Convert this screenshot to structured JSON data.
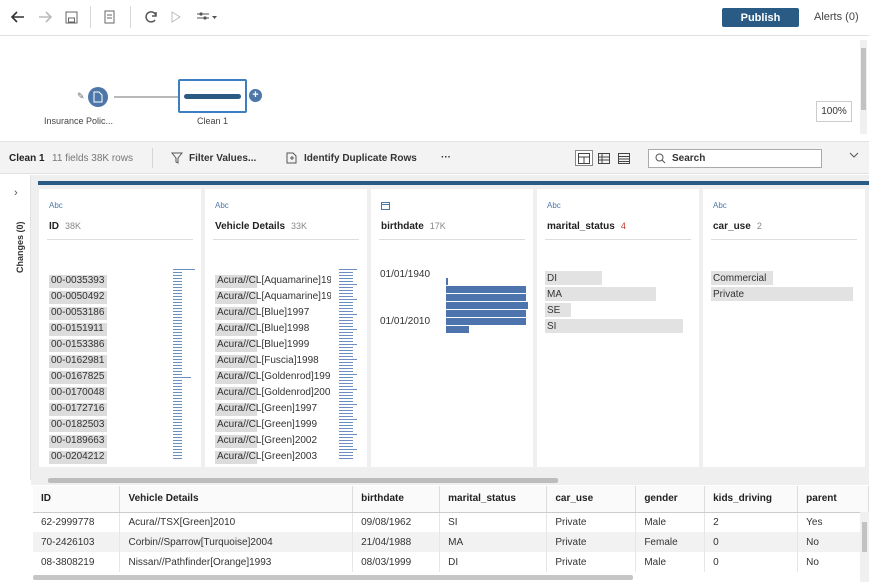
{
  "toolbar": {
    "icons": [
      "back-arrow-icon",
      "forward-arrow-icon",
      "save-icon",
      "save-to-file-icon",
      "refresh-icon",
      "run-icon",
      "flow-options-icon"
    ],
    "publish_label": "Publish",
    "alerts_label": "Alerts (0)"
  },
  "flow": {
    "input_node_label": "Insurance Polic...",
    "clean_node_label": "Clean 1",
    "zoom": "100%"
  },
  "step": {
    "title": "Clean 1",
    "meta": "11 fields  38K rows",
    "filter_label": "Filter Values...",
    "duplicate_label": "Identify Duplicate Rows",
    "more_label": "···",
    "search_label": "Search"
  },
  "changes": {
    "label": "Changes (0)"
  },
  "profile": {
    "cards": [
      {
        "type": "Abc",
        "name": "ID",
        "count": "38K",
        "values": [
          "00-0035393",
          "00-0050492",
          "00-0053186",
          "00-0151911",
          "00-0153386",
          "00-0162981",
          "00-0167825",
          "00-0170048",
          "00-0172716",
          "00-0182503",
          "00-0189663",
          "00-0204212"
        ]
      },
      {
        "type": "Abc",
        "name": "Vehicle Details",
        "count": "33K",
        "values": [
          "Acura//CL[Aquamarine]19",
          "Acura//CL[Aquamarine]19",
          "Acura//CL[Blue]1997",
          "Acura//CL[Blue]1998",
          "Acura//CL[Blue]1999",
          "Acura//CL[Fuscia]1998",
          "Acura//CL[Goldenrod]199",
          "Acura//CL[Goldenrod]200",
          "Acura//CL[Green]1997",
          "Acura//CL[Green]1999",
          "Acura//CL[Green]2002",
          "Acura//CL[Green]2003"
        ]
      },
      {
        "type": "date",
        "name": "birthdate",
        "count": "17K",
        "labels": [
          "01/01/1940",
          "01/01/2010"
        ],
        "histogram": [
          0.02,
          0.98,
          0.97,
          1.0,
          0.98,
          0.97,
          0.28
        ]
      },
      {
        "type": "Abc",
        "name": "marital_status",
        "count": "4",
        "values": [
          "DI",
          "MA",
          "SE",
          "SI"
        ],
        "proportions": [
          0.4,
          0.78,
          0.18,
          0.97
        ]
      },
      {
        "type": "Abc",
        "name": "car_use",
        "count": "2",
        "values": [
          "Commercial",
          "Private"
        ],
        "proportions": [
          0.44,
          1.0
        ]
      }
    ]
  },
  "grid": {
    "columns": [
      "ID",
      "Vehicle Details",
      "birthdate",
      "marital_status",
      "car_use",
      "gender",
      "kids_driving",
      "parent"
    ],
    "rows": [
      [
        "62-2999778",
        "Acura//TSX[Green]2010",
        "09/08/1962",
        "SI",
        "Private",
        "Male",
        "2",
        "Yes"
      ],
      [
        "70-2426103",
        "Corbin//Sparrow[Turquoise]2004",
        "21/04/1988",
        "MA",
        "Private",
        "Female",
        "0",
        "No"
      ],
      [
        "08-3808219",
        "Nissan//Pathfinder[Orange]1993",
        "08/03/1999",
        "DI",
        "Private",
        "Male",
        "0",
        "No"
      ]
    ]
  },
  "colors": {
    "accent": "#2a5b84",
    "bar": "#4e74ad",
    "selection": "#3c7dc4"
  }
}
